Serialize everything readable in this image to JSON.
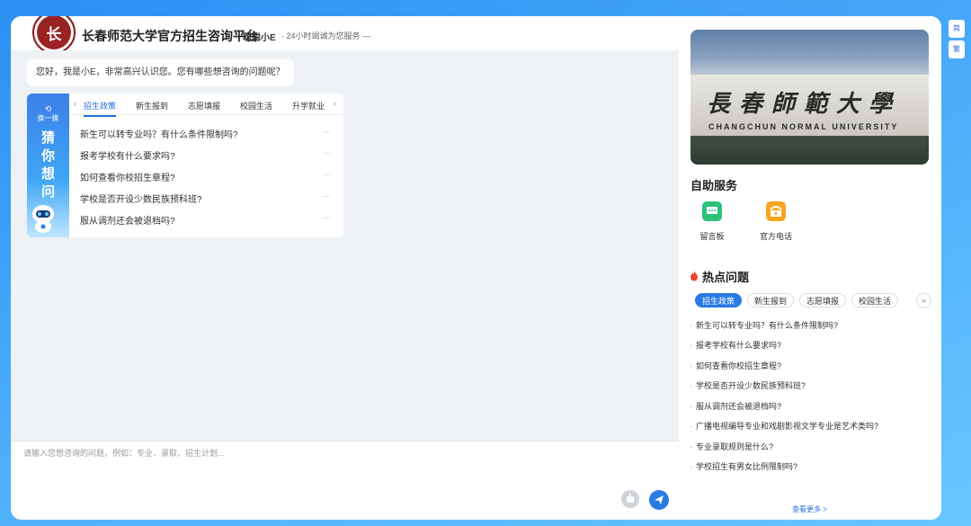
{
  "header": {
    "logo_text": "长",
    "title": "长春师范大学官方招生咨询平台",
    "assistant_name": "聪聪小E",
    "slogan": "· 24小时竭诚为您服务 —"
  },
  "chat": {
    "greeting": "您好，我是小E，非常高兴认识您。您有哪些想咨询的问题呢？",
    "guess_panel": {
      "swap_label": "换一换",
      "title": "猜你想问",
      "tabs": [
        "招生政策",
        "新生报到",
        "志愿填报",
        "校园生活",
        "升学就业"
      ],
      "active_tab": 0,
      "questions": [
        "新生可以转专业吗？有什么条件限制吗?",
        "报考学校有什么要求吗?",
        "如何查看你校招生章程?",
        "学校是否开设少数民族预科班?",
        "服从调剂还会被退档吗?"
      ],
      "dots": "···"
    }
  },
  "input": {
    "placeholder": "请输入您想咨询的问题，例如：专业、录取、招生计划..."
  },
  "banner": {
    "cn_text": "長春師範大學",
    "en_text": "CHANGCHUN NORMAL UNIVERSITY",
    "slide_count": 8,
    "active_slide": 1
  },
  "self_service": {
    "title": "自助服务",
    "items": [
      {
        "label": "留言板",
        "icon": "message-board-icon",
        "color": "#2fc27a"
      },
      {
        "label": "官方电话",
        "icon": "phone-icon",
        "color": "#f5a623"
      }
    ]
  },
  "hot": {
    "title": "热点问题",
    "tabs": [
      "招生政策",
      "新生报到",
      "志愿填报",
      "校园生活"
    ],
    "active_tab": 0,
    "questions": [
      "新生可以转专业吗？有什么条件限制吗?",
      "报考学校有什么要求吗?",
      "如何查看你校招生章程?",
      "学校是否开设少数民族预科班?",
      "服从调剂还会被退档吗?",
      "广播电视编导专业和戏剧影视文学专业是艺术类吗?",
      "专业录取规则是什么?",
      "学校招生有男女比例限制吗?"
    ],
    "see_more": "查看更多 >"
  },
  "side_tools": [
    "简",
    "繁"
  ],
  "colors": {
    "accent": "#2a7ae4",
    "bg": "#eef1f5"
  }
}
